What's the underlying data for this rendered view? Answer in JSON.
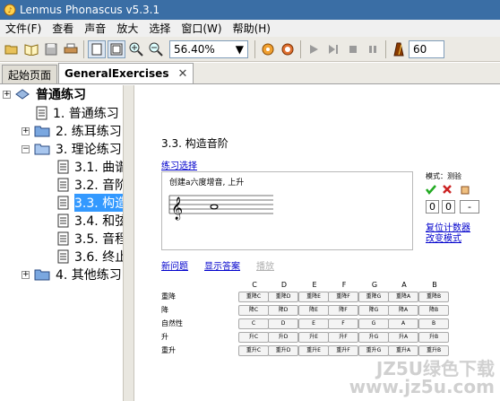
{
  "window": {
    "title": "Lenmus Phonascus v5.3.1"
  },
  "menu": [
    "文件(F)",
    "查看",
    "声音",
    "放大",
    "选择",
    "窗口(W)",
    "帮助(H)"
  ],
  "toolbar": {
    "zoom_value": "56.40%",
    "tempo_value": "60"
  },
  "tabs": [
    {
      "label": "起始页面",
      "active": false
    },
    {
      "label": "GeneralExercises",
      "active": true
    }
  ],
  "tree": {
    "root": "普通练习",
    "items": [
      {
        "label": "1. 普通练习"
      },
      {
        "label": "2. 练耳练习"
      },
      {
        "label": "3. 理论练习"
      },
      {
        "label": "3.1. 曲谱"
      },
      {
        "label": "3.2. 音阶"
      },
      {
        "label": "3.3. 构造"
      },
      {
        "label": "3.4. 和弦"
      },
      {
        "label": "3.5. 音程"
      },
      {
        "label": "3.6. 终止"
      },
      {
        "label": "4. 其他练习"
      }
    ]
  },
  "content": {
    "section_title": "3.3. 构造音阶",
    "settings_link": "练习选择",
    "problem_text": "创建a六度增音, 上升",
    "mode_label": "模式：测验",
    "scores": [
      "0",
      "0",
      "-"
    ],
    "reset_link": "复位计数器",
    "change_mode_link": "改变模式",
    "new_problem": "新问题",
    "show_answer": "显示答案",
    "play": "播放",
    "columns": [
      "C",
      "D",
      "E",
      "F",
      "G",
      "A",
      "B"
    ],
    "rows": [
      {
        "label": "重降",
        "buttons": [
          "重降C",
          "重降D",
          "重降E",
          "重降F",
          "重降G",
          "重降A",
          "重降B"
        ]
      },
      {
        "label": "降",
        "buttons": [
          "降C",
          "降D",
          "降E",
          "降F",
          "降G",
          "降A",
          "降B"
        ]
      },
      {
        "label": "自然性",
        "buttons": [
          "C",
          "D",
          "E",
          "F",
          "G",
          "A",
          "B"
        ]
      },
      {
        "label": "升",
        "buttons": [
          "升C",
          "升D",
          "升E",
          "升F",
          "升G",
          "升A",
          "升B"
        ]
      },
      {
        "label": "重升",
        "buttons": [
          "重升C",
          "重升D",
          "重升E",
          "重升F",
          "重升G",
          "重升A",
          "重升B"
        ]
      }
    ]
  },
  "watermark": "JZ5U绿色下载 www.jz5u.com",
  "colors": {
    "titlebar": "#3a6ea5",
    "link": "#0000cc",
    "selection": "#3399ff"
  }
}
